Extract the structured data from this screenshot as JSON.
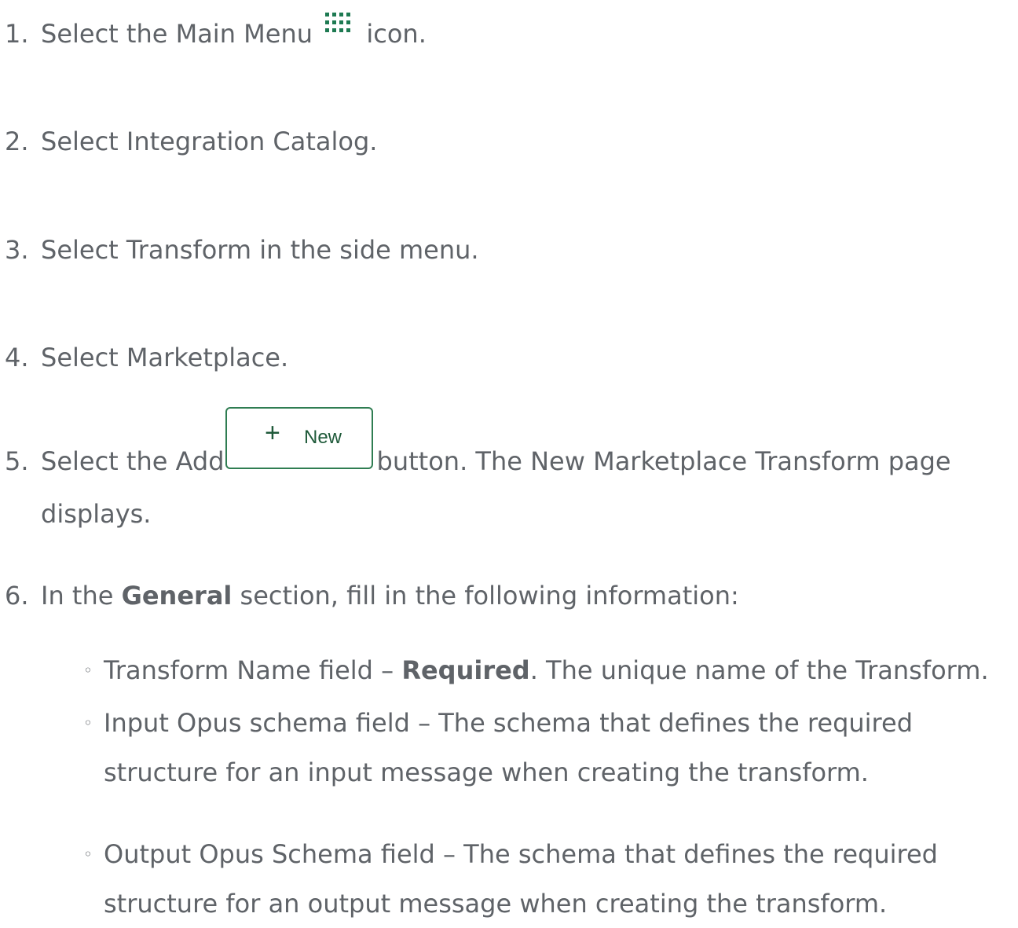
{
  "steps": [
    {
      "num": "1.",
      "pre": "Select the Main Menu",
      "post": "icon.",
      "icon": "grid-menu-icon"
    },
    {
      "num": "2.",
      "text": "Select Integration Catalog."
    },
    {
      "num": "3.",
      "text": "Select Transform in the side menu."
    },
    {
      "num": "4.",
      "text": "Select Marketplace."
    },
    {
      "num": "5.",
      "pre": "Select the Add",
      "post": "button. The New Marketplace Transform page",
      "cont": "displays."
    },
    {
      "num": "6.",
      "pre": "In the",
      "bold": "General",
      "post": "section, fill in the following information:"
    }
  ],
  "new_button": {
    "label": "New",
    "icon": "plus-icon",
    "color": "#2f7d52"
  },
  "bullets": [
    {
      "pre": "Transform Name field –",
      "bold": "Required",
      "post": ". The unique name of the Transform."
    },
    {
      "line1": "Input Opus schema field – The schema that defines the required",
      "line2": "structure for an input message when creating the transform."
    },
    {
      "line1": "Output Opus Schema field – The schema that defines the required",
      "line2": "structure for an output message when creating the transform."
    }
  ],
  "bullet_mark": "◦",
  "accent_color": "#1e7a52"
}
